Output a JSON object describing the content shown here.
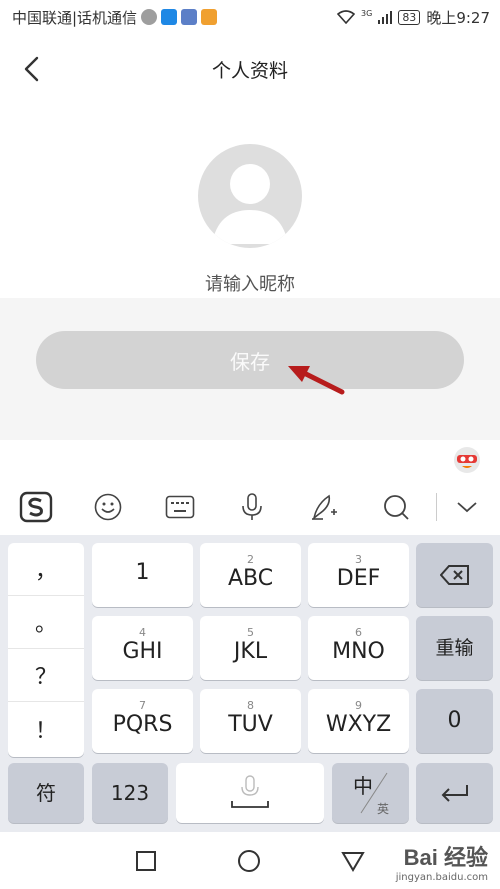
{
  "status_bar": {
    "carrier": "中国联通|话机通信",
    "network": "3G",
    "battery": "83",
    "time": "晚上9:27"
  },
  "header": {
    "title": "个人资料",
    "back_icon": "chevron-left-icon"
  },
  "profile": {
    "avatar_icon": "default-avatar-icon",
    "nickname_placeholder": "请输入昵称",
    "nickname_value": ""
  },
  "save_button": {
    "label": "保存",
    "annotation": "red-arrow-icon"
  },
  "keyboard": {
    "toolbar": [
      "sogou-logo-icon",
      "emoji-icon",
      "keyboard-icon",
      "microphone-icon",
      "handwriting-icon",
      "search-icon",
      "collapse-chevron-icon"
    ],
    "punctuation": [
      "，",
      "。",
      "？",
      "！"
    ],
    "keys": [
      {
        "num": "",
        "label": "1"
      },
      {
        "num": "2",
        "label": "ABC"
      },
      {
        "num": "3",
        "label": "DEF"
      },
      {
        "num": "4",
        "label": "GHI"
      },
      {
        "num": "5",
        "label": "JKL"
      },
      {
        "num": "6",
        "label": "MNO"
      },
      {
        "num": "7",
        "label": "PQRS"
      },
      {
        "num": "8",
        "label": "TUV"
      },
      {
        "num": "9",
        "label": "WXYZ"
      }
    ],
    "retype_label": "重输",
    "zero_label": "0",
    "symbol_label": "符",
    "num_label": "123",
    "lang_main": "中",
    "lang_sub": "英"
  },
  "watermark": {
    "logo": "Bai 经验",
    "url": "jingyan.baidu.com"
  },
  "colors": {
    "save_button_bg": "#d3d3d3",
    "arrow": "#b71c1c",
    "keyboard_bg": "#e9ebf0"
  }
}
